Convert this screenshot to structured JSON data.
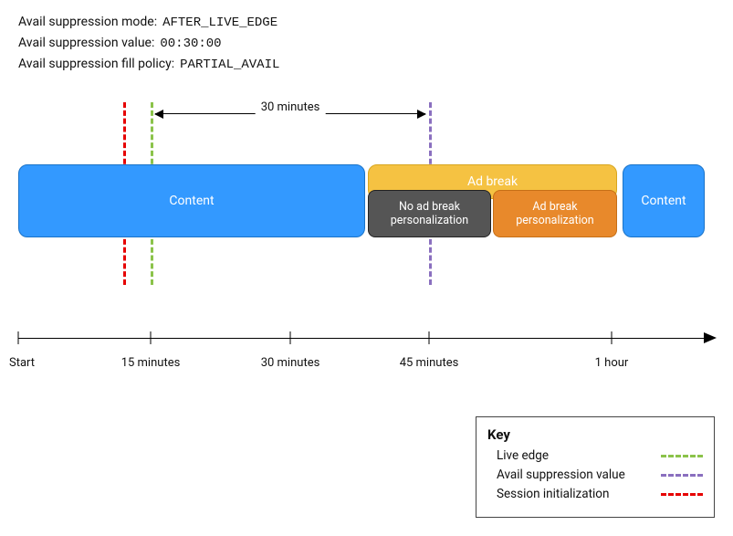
{
  "settings": {
    "mode_label": "Avail suppression mode:",
    "mode_value": "AFTER_LIVE_EDGE",
    "value_label": "Avail suppression value:",
    "value_value": "00:30:00",
    "fill_label": "Avail suppression fill policy:",
    "fill_value": "PARTIAL_AVAIL"
  },
  "span_label": "30 minutes",
  "blocks": {
    "content1": "Content",
    "adbreak": "Ad break",
    "noad": "No ad break personalization",
    "adpers": "Ad break personalization",
    "content2": "Content"
  },
  "axis": {
    "start": "Start",
    "t15": "15 minutes",
    "t30": "30 minutes",
    "t45": "45 minutes",
    "t60": "1 hour"
  },
  "chart_data": {
    "type": "timeline",
    "unit": "minutes",
    "range": [
      0,
      65
    ],
    "axis_ticks": [
      0,
      15,
      30,
      45,
      60
    ],
    "axis_labels": [
      "Start",
      "15 minutes",
      "30 minutes",
      "45 minutes",
      "1 hour"
    ],
    "segments": [
      {
        "name": "Content",
        "start": 0,
        "end": 33,
        "color": "#3399ff"
      },
      {
        "name": "Ad break",
        "start": 33,
        "end": 57,
        "color": "#f5c242",
        "sub": [
          {
            "name": "No ad break personalization",
            "start": 33,
            "end": 45,
            "color": "#555555"
          },
          {
            "name": "Ad break personalization",
            "start": 45,
            "end": 57,
            "color": "#e8892b"
          }
        ]
      },
      {
        "name": "Content",
        "start": 58,
        "end": 65,
        "color": "#3399ff"
      }
    ],
    "markers": [
      {
        "name": "Session initialization",
        "at": 12,
        "style": "dashed",
        "color": "#e60000"
      },
      {
        "name": "Live edge",
        "at": 15,
        "style": "dashed",
        "color": "#8bc34a"
      },
      {
        "name": "Avail suppression value",
        "at": 45,
        "style": "dashed",
        "color": "#8a6fbf"
      }
    ],
    "span_annotation": {
      "from": 15,
      "to": 45,
      "label": "30 minutes"
    }
  },
  "legend": {
    "title": "Key",
    "live_edge": "Live edge",
    "avail_suppression_value": "Avail suppression value",
    "session_init": "Session initialization"
  }
}
